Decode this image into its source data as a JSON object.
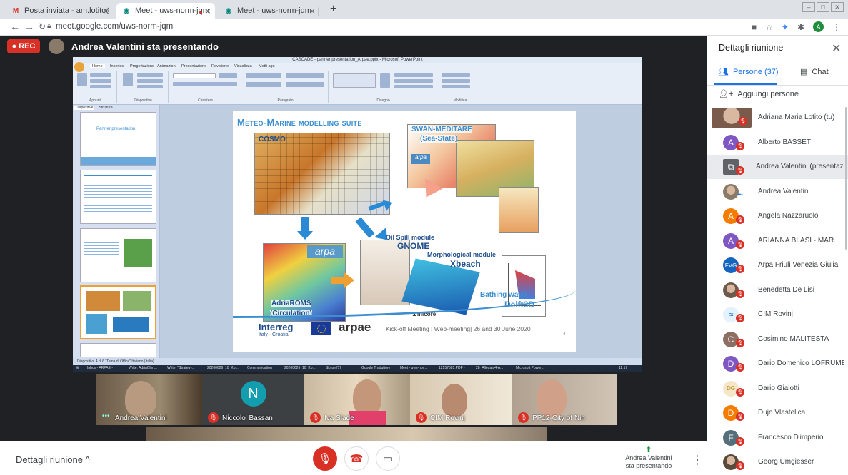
{
  "browser": {
    "tabs": [
      {
        "icon": "gmail-icon",
        "label": "Posta inviata - am.lotito@regione",
        "active": false
      },
      {
        "icon": "meet-icon",
        "label": "Meet - uws-norm-jqm",
        "active": true
      },
      {
        "icon": "meet-icon",
        "label": "Meet - uws-norm-jqm",
        "active": false
      }
    ],
    "url": "meet.google.com/uws-norm-jqm"
  },
  "meet": {
    "rec_label": "REC",
    "presenting_title": "Andrea Valentini sta presentando",
    "details_label": "Dettagli riunione",
    "presenting_btn_line1": "Andrea Valentini",
    "presenting_btn_line2": "sta presentando"
  },
  "powerpoint": {
    "window_title": "CASCADE - partner presentation_Arpae.pptx - Microsoft PowerPoint",
    "ribbon_tabs": [
      "Home",
      "Inserisci",
      "Progettazione",
      "Animazioni",
      "Presentazione",
      "Revisione",
      "Visualizza",
      "Metti ago"
    ],
    "ribbon_groups": [
      "Appunti",
      "Diapositive",
      "Carattere",
      "Paragrafo",
      "Disegno",
      "Modifica"
    ],
    "panel_tabs": [
      "Diapositive",
      "Struttura"
    ],
    "status": "Diapositiva 4 di 6   \"Tema di Office\"   Italiano (Italia)",
    "thumb_title": "Partner presentation"
  },
  "slide": {
    "title": "Meteo-Marine modelling suite",
    "labels": {
      "cosmo": "COSMO",
      "swan": "SWAN-MEDITARE",
      "swan_sub": "(Sea-State)",
      "oil": "Oil Spill module",
      "gnome": "GNOME",
      "morph": "Morphological module",
      "xbeach": "Xbeach",
      "adria": "AdriaROMS",
      "adria_sub": "(Circulation)",
      "bathing": "Bathing water",
      "delft": "Delft3D",
      "arpa": "arpa",
      "micore": "micore"
    },
    "footer": {
      "interreg": "Interreg",
      "interreg_sub": "Italy - Croatia",
      "arpae": "arpae",
      "meeting": "Kick-off Meeting | Web-meeting| 26 and 30 June 2020",
      "page": "4"
    }
  },
  "taskbar": {
    "items": [
      "Inbox - ARPAE -",
      "Write: AdriaClim...",
      "Write: \"Strategy...",
      "20200626_10_Ko...",
      "Communication",
      "20200626_10_Ko...",
      "Skype [1]",
      "Google Traduttore",
      "Meet - uws-nor...",
      "12157585.PDF -",
      "28_Allegato4-A...",
      "Microsoft Power..."
    ],
    "clock": "11:17"
  },
  "tiles": [
    {
      "name": "Andrea Valentini",
      "muted": false
    },
    {
      "name": "Niccolo' Bassan",
      "letter": "N",
      "muted": true
    },
    {
      "name": "Iva Slade",
      "muted": true
    },
    {
      "name": "CIM Rovinj",
      "muted": true
    },
    {
      "name": "PP12-City of Nin",
      "muted": true
    }
  ],
  "panel": {
    "title": "Dettagli riunione",
    "people_tab": "Persone (37)",
    "chat_tab": "Chat",
    "add_people": "Aggiungi persone",
    "participants": [
      {
        "name": "Adriana Maria Lotito (tu)",
        "avatar": "photo",
        "color": "#7a5a4a"
      },
      {
        "name": "Alberto BASSET",
        "avatar": "A",
        "color": "#7e57c2"
      },
      {
        "name": "Andrea Valentini (presentazione)",
        "avatar": "screen",
        "color": "#5f6368"
      },
      {
        "name": "Andrea Valentini",
        "avatar": "photo",
        "color": "#8a7a6a"
      },
      {
        "name": "Angela Nazzaruolo",
        "avatar": "A",
        "color": "#f57c00"
      },
      {
        "name": "ARIANNA BLASI - MAR...",
        "avatar": "A",
        "color": "#7e57c2"
      },
      {
        "name": "Arpa Friuli Venezia Giulia",
        "avatar": "FVG",
        "color": "#1565c0"
      },
      {
        "name": "Benedetta De Lisi",
        "avatar": "photo",
        "color": "#6d5a4a"
      },
      {
        "name": "CIM Rovinj",
        "avatar": "logo",
        "color": "#e3f2fd"
      },
      {
        "name": "Cosimino MALITESTA",
        "avatar": "C",
        "color": "#8d6e63"
      },
      {
        "name": "Dario Domenico LOFRUMENTO",
        "avatar": "D",
        "color": "#7e57c2"
      },
      {
        "name": "Dario Gialotti",
        "avatar": "DG",
        "color": "#f5e6c8"
      },
      {
        "name": "Dujo Vlastelica",
        "avatar": "D",
        "color": "#f57c00"
      },
      {
        "name": "Francesco D'imperio",
        "avatar": "F",
        "color": "#546e7a"
      },
      {
        "name": "Georg Umgiesser",
        "avatar": "photo",
        "color": "#5a4a3a"
      }
    ]
  }
}
